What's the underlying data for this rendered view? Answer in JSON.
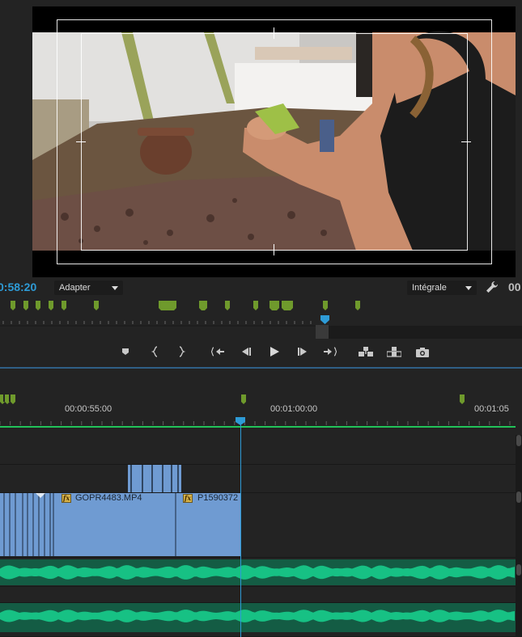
{
  "monitor": {
    "timecode": "0:58:20",
    "zoom_select": "Adapter",
    "quality_select": "Intégrale",
    "cut_timecode": "00"
  },
  "timeline": {
    "ruler_labels": [
      "00:00:55:00",
      "00:01:00:00",
      "00:01:05"
    ],
    "clips": [
      {
        "name": "GOPR4483.MP4",
        "fx": "fx"
      },
      {
        "name": "P1590372",
        "fx": "fx"
      }
    ]
  },
  "icons": {
    "transport": [
      "add-marker-icon",
      "mark-in-icon",
      "mark-out-icon",
      "go-to-in-icon",
      "step-back-icon",
      "play-icon",
      "step-forward-icon",
      "go-to-out-icon",
      "insert-icon",
      "overwrite-icon",
      "export-frame-icon"
    ],
    "settings": "wrench-icon"
  },
  "colors": {
    "timecode": "#2e9bd6",
    "marker": "#6f9a2c",
    "video_clip": "#6f9bd2",
    "audio_wave": "#17c184",
    "playbar": "#22c35a"
  }
}
